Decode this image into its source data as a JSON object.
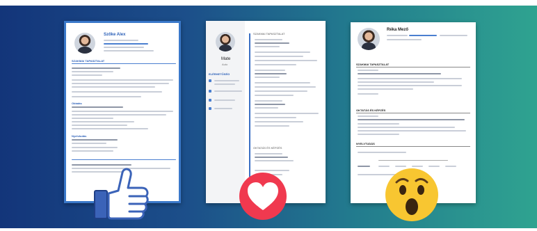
{
  "documents": [
    {
      "name": "Szőke Alex",
      "section_1": "SZAKMAI TAPASZTALAT",
      "section_2": "Oktatás",
      "section_3": "Nyelvtudás"
    },
    {
      "name": "Mate",
      "subtitle": "Auto",
      "sidebar_heading": "ELÉRHETŐSÉG",
      "section_1": "SZAKMAI TAPASZTALAT",
      "section_2": "OKTATÁS ÉS KÉPZÉS"
    },
    {
      "name": "Réka Mező",
      "section_1": "SZAKMAI TAPASZTALAT",
      "section_2": "OKTATÁS ÉS KÉPZÉS",
      "section_3": "NYELVTUDÁS"
    }
  ],
  "reactions": [
    {
      "icon": "thumbs-up-icon",
      "color": "#3b63b8"
    },
    {
      "icon": "heart-icon",
      "color": "#f0394f"
    },
    {
      "icon": "wow-face-icon",
      "color": "#f8c631"
    }
  ],
  "colors": {
    "gradient_start": "#13357a",
    "gradient_end": "#2fa390",
    "accent_blue": "#3a78c9"
  }
}
